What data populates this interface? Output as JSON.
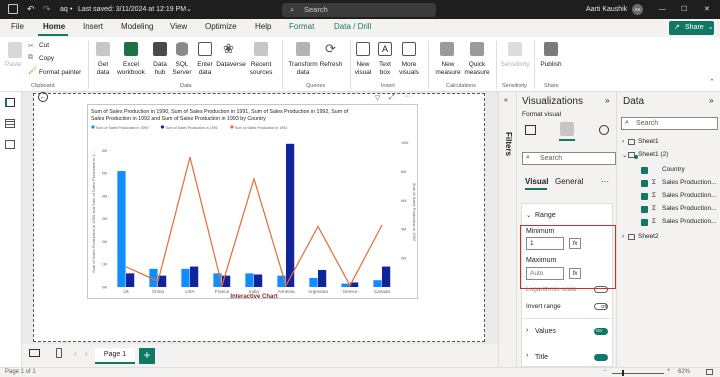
{
  "titlebar": {
    "doc_name": "aq",
    "saved": "Last saved: 3/11/2024 at 12:19 PM",
    "search": "Search",
    "user": "Aarti Kaushik",
    "user_initials": "AK"
  },
  "menu": {
    "items": [
      "File",
      "Home",
      "Insert",
      "Modeling",
      "View",
      "Optimize",
      "Help",
      "Format",
      "Data / Drill"
    ],
    "share": "Share"
  },
  "ribbon": {
    "clipboard": {
      "paste": "Paste",
      "cut": "Cut",
      "copy": "Copy",
      "format_painter": "Format painter",
      "group": "Clipboard"
    },
    "data": {
      "get_data": "Get data",
      "excel": "Excel workbook",
      "hub": "Data hub",
      "sql": "SQL Server",
      "enter": "Enter data",
      "dataverse": "Dataverse",
      "recent": "Recent sources",
      "group": "Data"
    },
    "queries": {
      "transform": "Transform data",
      "refresh": "Refresh",
      "group": "Queries"
    },
    "insert": {
      "new_visual": "New visual",
      "text_box": "Text box",
      "more_visuals": "More visuals",
      "group": "Insert"
    },
    "calculations": {
      "new_measure": "New measure",
      "quick_measure": "Quick measure",
      "group": "Calculations"
    },
    "sensitivity": {
      "label": "Sensitivity",
      "group": "Sensitivity"
    },
    "share": {
      "publish": "Publish",
      "group": "Share"
    }
  },
  "chart_title": "Sum of Sales Production in 1990, Sum of Sales Production in 1991, Sum of Sales Production in 1992, Sum of Sales Production in 1992 and Sum of Sales Production in 1993 by Country",
  "chart_data": {
    "type": "bar",
    "categories": [
      "Uk",
      "China",
      "USA",
      "France",
      "India",
      "Armenia",
      "Argentina",
      "Greece",
      "Canada"
    ],
    "legend": [
      "Sum of Sales Production in 1990",
      "Sum of Sales Production in 1991",
      "Sum of Sales Production in 1992"
    ],
    "series": [
      {
        "name": "Sum of Sales Production in 1990",
        "color": "#118dff",
        "values": [
          5.1,
          0.8,
          0.8,
          0.6,
          0.6,
          0.5,
          0.4,
          0.15,
          0.3
        ]
      },
      {
        "name": "Sum of Sales Production in 1991",
        "color": "#12239e",
        "values": [
          0.6,
          0.5,
          0.9,
          0.5,
          0.55,
          6.3,
          0.75,
          0.2,
          0.9
        ]
      },
      {
        "name": "Sum of Sales Production in 1992",
        "type": "line",
        "axis": "right",
        "color": "#e66c37",
        "values": [
          1.4,
          0.4,
          9.0,
          0.1,
          7.5,
          0.1,
          4.2,
          0.1,
          4.3
        ]
      }
    ],
    "y_left_ticks": [
      "0M",
      "1M",
      "2M",
      "3M",
      "4M",
      "5M",
      "6M"
    ],
    "y_right_ticks": [
      "2M",
      "4M",
      "6M",
      "8M",
      "10M"
    ],
    "ylabel_left": "Sum of Sales Production in 1990 and Sum of Sales Production in 1...",
    "ylabel_right": "Sum of Sales Production in 1992",
    "xlabel": "Interactive Chart",
    "ylim_left": [
      0,
      6.6
    ],
    "ylim_right": [
      0,
      10.4
    ]
  },
  "pages": {
    "tab": "Page 1",
    "add": "+"
  },
  "status": {
    "page": "Page 1 of 1",
    "zoom": "62%"
  },
  "filters_label": "Filters",
  "viz_pane": {
    "title": "Visualizations",
    "subtitle": "Format visual",
    "search": "Search",
    "tab_visual": "Visual",
    "tab_general": "General",
    "more": "···",
    "section_range": "Range",
    "minimum_label": "Minimum",
    "minimum_value": "1",
    "maximum_label": "Maximum",
    "maximum_placeholder": "Auto",
    "fx": "fx",
    "log_scale": "Logarithmic scale",
    "log_state": "Off",
    "invert_range": "Invert range",
    "invert_state": "Off",
    "values": "Values",
    "values_state": "On",
    "title_section": "Title"
  },
  "data_pane": {
    "title": "Data",
    "search": "Search",
    "tables": [
      {
        "name": "Sheet1",
        "expanded": false
      },
      {
        "name": "Sheet1 (2)",
        "expanded": true,
        "fields": [
          "Country",
          "Sales Production...",
          "Sales Production...",
          "Sales Production...",
          "Sales Production..."
        ]
      },
      {
        "name": "Sheet2",
        "expanded": false
      }
    ]
  },
  "colors": {
    "accent": "#117865",
    "highlight_box": "#c9302c"
  }
}
